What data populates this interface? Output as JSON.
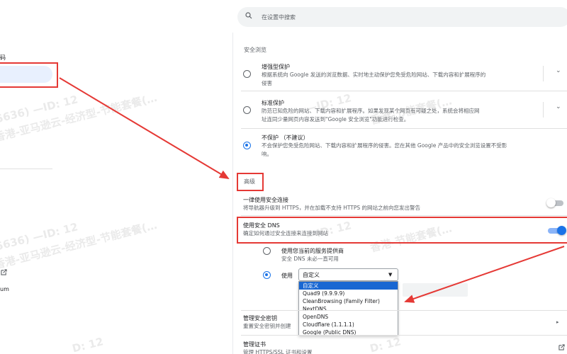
{
  "search": {
    "placeholder": "在设置中搜索"
  },
  "sidebar": {
    "partial_item_label": "码",
    "chromium_label": "um"
  },
  "safe_browsing": {
    "title": "安全浏览",
    "options": [
      {
        "title": "增强型保护",
        "desc_line1": "根据系统向 Google 发送的浏览数据、实时地主动保护您免受危险网站、下载内容和扩展程序的",
        "desc_line2": "侵害",
        "selected": false
      },
      {
        "title": "标准保护",
        "desc_line1": "防范已知危险的网站、下载内容和扩展程序。如果发现某个网页有可疑之处，系统会将相应网",
        "desc_line2": "址连同少量网页内容发送到\"Google 安全浏览\"功能进行检查。",
        "selected": false
      },
      {
        "title": "不保护 （不建议）",
        "desc_line1": "不会保护您免受危险网站、下载内容和扩展程序的侵害。您在其他 Google 产品中的安全浏览设置不受影",
        "desc_line2": "响。",
        "selected": true
      }
    ]
  },
  "advanced": {
    "title": "高级",
    "https": {
      "title": "一律使用安全连接",
      "desc": "将导航器升级到 HTTPS，并在加载不支持 HTTPS 的网站之前向您发出警告",
      "enabled": false
    },
    "dns": {
      "title": "使用安全 DNS",
      "desc": "确定如何通过安全连接来连接到网站",
      "enabled": true,
      "current_provider": {
        "title": "使用您当前的服务提供商",
        "desc": "安全 DNS 未必一直可用",
        "selected": false
      },
      "custom": {
        "label": "使用",
        "selected": true,
        "select_value": "自定义"
      },
      "providers": [
        "自定义",
        "Quad9 (9.9.9.9)",
        "CleanBrowsing (Family Filter)",
        "NextDNS",
        "OpenDNS",
        "Cloudflare (1.1.1.1)",
        "Google (Public DNS)"
      ]
    },
    "manage_keys": {
      "title": "管理安全密钥",
      "desc": "重置安全密钥并创建"
    },
    "manage_certs": {
      "title": "管理证书",
      "desc": "管理 HTTPS/SSL 证书和设置"
    }
  },
  "watermarks": [
    "5636) —ID: 12",
    "香港-亚马逊云-经济型-节能套餐(…",
    "—ID: 12",
    "香港-节能套餐(…",
    "D: 12"
  ],
  "colors": {
    "accent": "#1a73e8",
    "annotation": "#e53935"
  }
}
